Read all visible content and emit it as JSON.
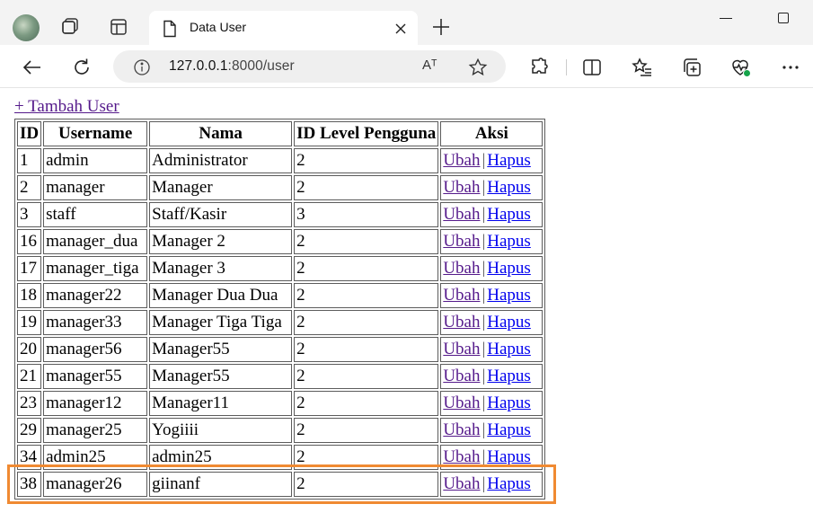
{
  "browser": {
    "tab_title": "Data User",
    "address": {
      "host": "127.0.0.1",
      "path": ":8000/user"
    },
    "read_aloud_glyph": "Aᵀ",
    "icons": {
      "profile": "profile-avatar-icon",
      "workspaces": "workspaces-icon",
      "tab_actions": "tab-actions-icon",
      "document": "document-icon",
      "close": "close-icon",
      "new_tab": "plus-icon",
      "back": "back-arrow-icon",
      "refresh": "refresh-icon",
      "info": "info-icon",
      "favorite": "star-icon",
      "extensions": "puzzle-icon",
      "split_screen": "split-screen-icon",
      "favorites": "favorites-list-icon",
      "collections": "collections-icon",
      "browser_essentials": "heart-pulse-icon",
      "more": "more-icon"
    },
    "colors": {
      "accent_green": "#16a34a",
      "titlebar": "#f3f3f3"
    }
  },
  "page": {
    "add_link": "+ Tambah User",
    "table": {
      "headers": [
        "ID",
        "Username",
        "Nama",
        "ID Level Pengguna",
        "Aksi"
      ],
      "rows": [
        {
          "id": "1",
          "username": "admin",
          "nama": "Administrator",
          "level": "2"
        },
        {
          "id": "2",
          "username": "manager",
          "nama": "Manager",
          "level": "2"
        },
        {
          "id": "3",
          "username": "staff",
          "nama": "Staff/Kasir",
          "level": "3"
        },
        {
          "id": "16",
          "username": "manager_dua",
          "nama": "Manager 2",
          "level": "2"
        },
        {
          "id": "17",
          "username": "manager_tiga",
          "nama": "Manager 3",
          "level": "2"
        },
        {
          "id": "18",
          "username": "manager22",
          "nama": "Manager Dua Dua",
          "level": "2"
        },
        {
          "id": "19",
          "username": "manager33",
          "nama": "Manager Tiga Tiga",
          "level": "2"
        },
        {
          "id": "20",
          "username": "manager56",
          "nama": "Manager55",
          "level": "2"
        },
        {
          "id": "21",
          "username": "manager55",
          "nama": "Manager55",
          "level": "2"
        },
        {
          "id": "23",
          "username": "manager12",
          "nama": "Manager11",
          "level": "2"
        },
        {
          "id": "29",
          "username": "manager25",
          "nama": "Yogiiii",
          "level": "2"
        },
        {
          "id": "34",
          "username": "admin25",
          "nama": "admin25",
          "level": "2"
        },
        {
          "id": "38",
          "username": "manager26",
          "nama": "giinanf",
          "level": "2"
        }
      ],
      "action_edit": "Ubah",
      "action_separator": "|",
      "action_delete": "Hapus"
    },
    "highlight_color": "#f08a32"
  }
}
